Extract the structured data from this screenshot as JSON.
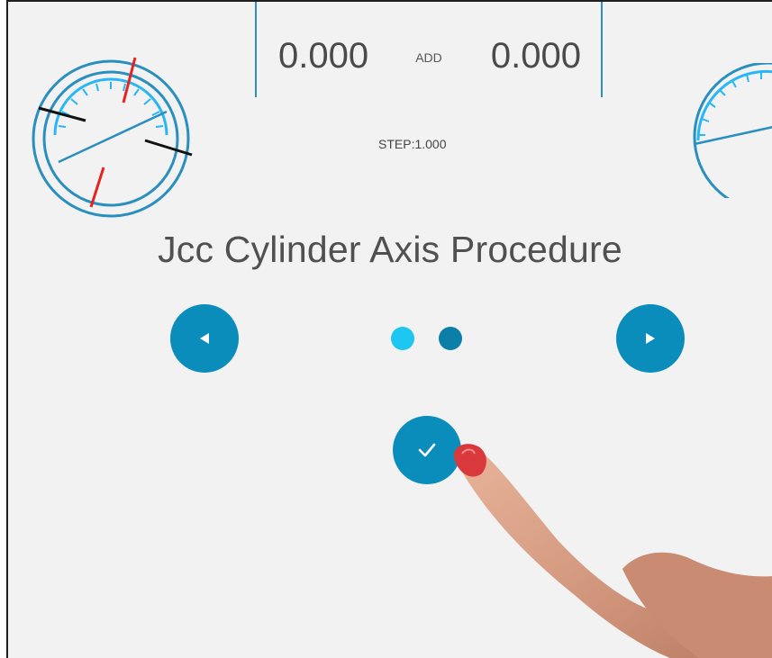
{
  "readout": {
    "left_value": "0.000",
    "mode_label": "ADD",
    "right_value": "0.000"
  },
  "step_label": "STEP:1.000",
  "title": "Jcc Cylinder Axis Procedure",
  "pager": {
    "total": 2,
    "current": 1
  },
  "icons": {
    "prev": "triangle-left-icon",
    "next": "triangle-right-icon",
    "confirm": "checkmark-icon",
    "left_dial": "axis-dial-icon",
    "right_dial": "axis-dial-icon"
  },
  "colors": {
    "accent": "#0b8dbc",
    "dot_active": "#1ec6f2",
    "dot_inactive": "#0b7fa8",
    "dial_ring": "#2a8fbf",
    "dial_ticks": "#29b6f6",
    "marker_red": "#e52421",
    "marker_black": "#111111",
    "background": "#f2f2f2"
  }
}
